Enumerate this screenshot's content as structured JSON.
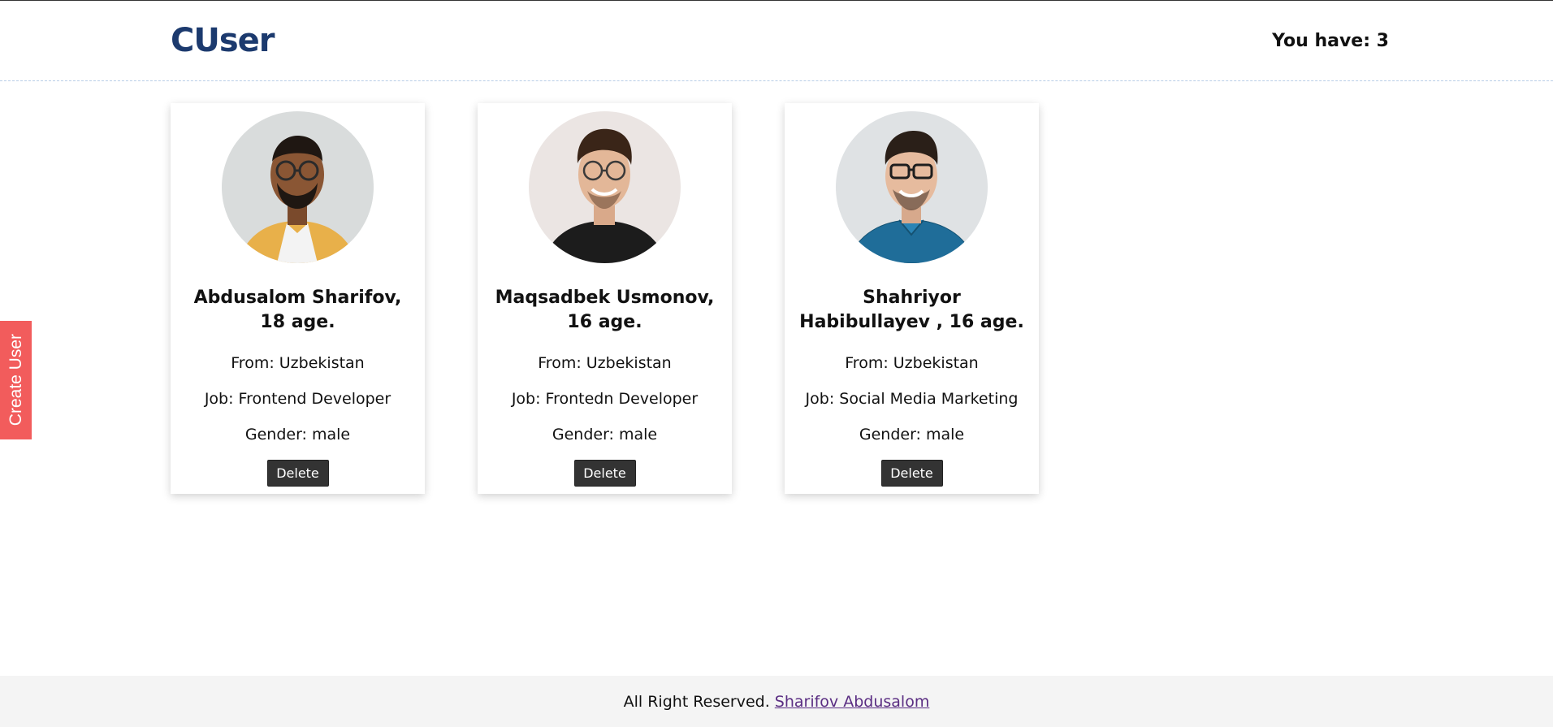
{
  "header": {
    "logo": "CUser",
    "counter_text": "You have: 3"
  },
  "sidebar": {
    "create_label": "Create User"
  },
  "users": [
    {
      "name": "Abdusalom Sharifov, 18 age.",
      "from": "From: Uzbekistan",
      "job": "Job: Frontend Developer",
      "gender": "Gender: male",
      "delete_label": "Delete"
    },
    {
      "name": "Maqsadbek Usmonov, 16 age.",
      "from": "From: Uzbekistan",
      "job": "Job: Frontedn Developer",
      "gender": "Gender: male",
      "delete_label": "Delete"
    },
    {
      "name": "Shahriyor Habibullayev , 16 age.",
      "from": "From: Uzbekistan",
      "job": "Job: Social Media Marketing",
      "gender": "Gender: male",
      "delete_label": "Delete"
    }
  ],
  "footer": {
    "text": "All Right Reserved.",
    "link_text": "Sharifov Abdusalom"
  },
  "colors": {
    "brand": "#1c3a6e",
    "create_tab": "#f25c5c",
    "delete_button": "#333333",
    "footer_link": "#5a2d82"
  }
}
